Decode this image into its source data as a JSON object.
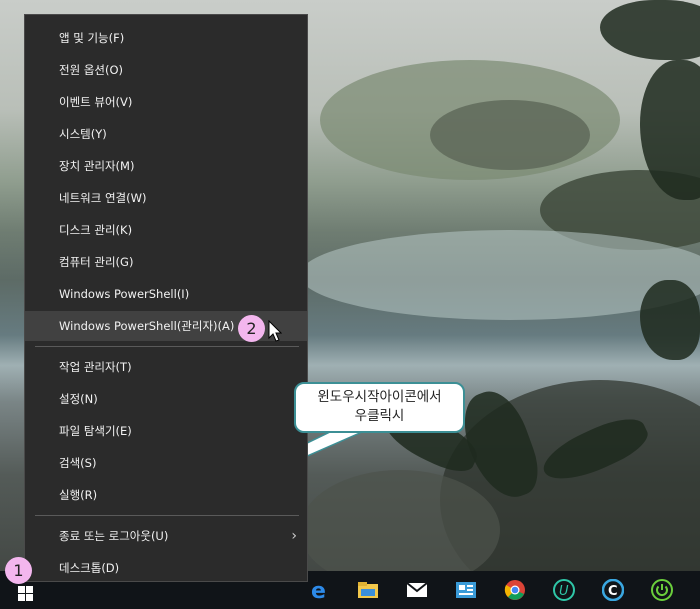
{
  "context_menu": {
    "items": [
      {
        "label": "앱 및 기능(F)"
      },
      {
        "label": "전원 옵션(O)"
      },
      {
        "label": "이벤트 뷰어(V)"
      },
      {
        "label": "시스템(Y)"
      },
      {
        "label": "장치 관리자(M)"
      },
      {
        "label": "네트워크 연결(W)"
      },
      {
        "label": "디스크 관리(K)"
      },
      {
        "label": "컴퓨터 관리(G)"
      },
      {
        "label": "Windows PowerShell(I)"
      },
      {
        "label": "Windows PowerShell(관리자)(A)"
      },
      {
        "label": "작업 관리자(T)"
      },
      {
        "label": "설정(N)"
      },
      {
        "label": "파일 탐색기(E)"
      },
      {
        "label": "검색(S)"
      },
      {
        "label": "실행(R)"
      },
      {
        "label": "종료 또는 로그아웃(U)"
      },
      {
        "label": "데스크톱(D)"
      }
    ],
    "highlighted_index": 9
  },
  "annotations": {
    "badge_1": "1",
    "badge_2": "2",
    "callout_line1": "윈도우시작아이콘에서",
    "callout_line2": "우클릭시"
  },
  "taskbar": {
    "icons": [
      "edge-icon",
      "file-explorer-icon",
      "mail-icon",
      "news-icon",
      "chrome-icon",
      "u-app-icon",
      "c-app-icon",
      "power-app-icon"
    ]
  },
  "colors": {
    "menu_bg": "#2b2b2b",
    "menu_highlight": "#414141",
    "badge_bg": "#f3b6ee",
    "callout_border": "#3c8f95"
  }
}
